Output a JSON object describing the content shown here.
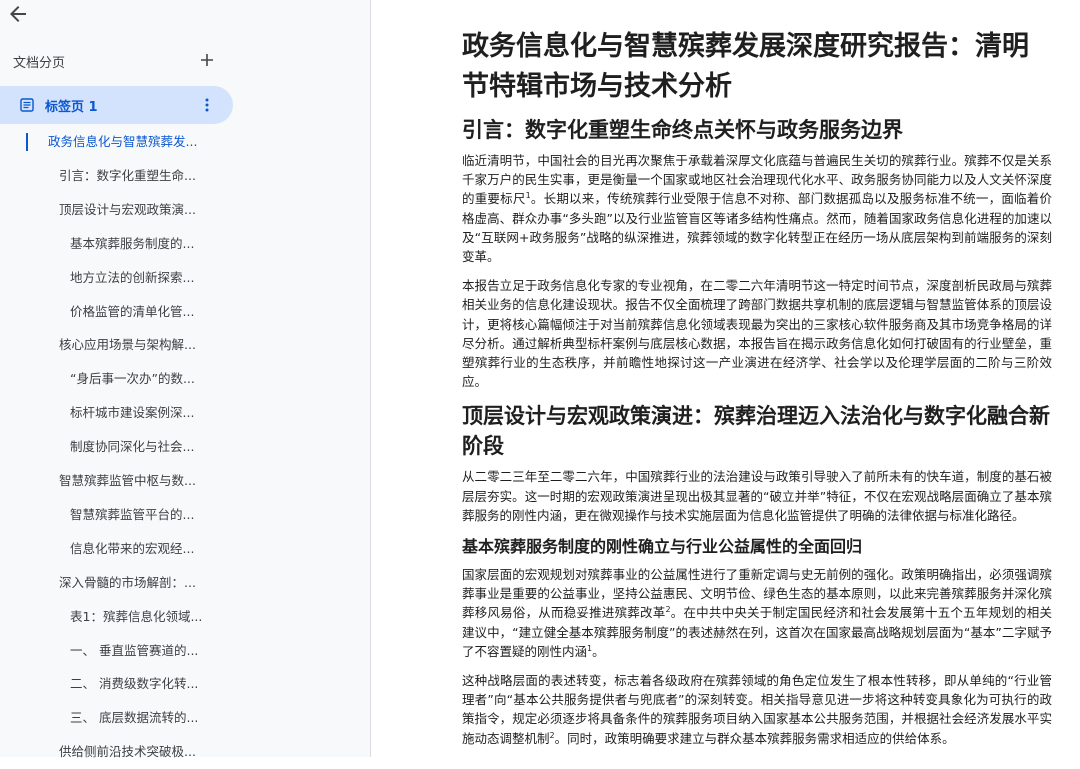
{
  "sidebar": {
    "pages_header": "文档分页",
    "tab_label": "标签页 1",
    "outline": [
      {
        "label": "政务信息化与智慧殡葬发...",
        "level": 1,
        "active": true
      },
      {
        "label": "引言：数字化重塑生命...",
        "level": 2
      },
      {
        "label": "顶层设计与宏观政策演...",
        "level": 2
      },
      {
        "label": "基本殡葬服务制度的...",
        "level": 3
      },
      {
        "label": "地方立法的创新探索...",
        "level": 3
      },
      {
        "label": "价格监管的清单化管...",
        "level": 3
      },
      {
        "label": "核心应用场景与架构解...",
        "level": 2
      },
      {
        "label": "“身后事一次办”的数...",
        "level": 3
      },
      {
        "label": "标杆城市建设案例深...",
        "level": 3
      },
      {
        "label": "制度协同深化与社会...",
        "level": 3
      },
      {
        "label": "智慧殡葬监管中枢与数...",
        "level": 2
      },
      {
        "label": "智慧殡葬监管平台的...",
        "level": 3
      },
      {
        "label": "信息化带来的宏观经...",
        "level": 3
      },
      {
        "label": "深入骨髓的市场解剖：...",
        "level": 2
      },
      {
        "label": "表1：殡葬信息化领域...",
        "level": 3
      },
      {
        "label": "一、 垂直监管赛道的...",
        "level": 3
      },
      {
        "label": "二、 消费级数字化转...",
        "level": 3
      },
      {
        "label": "三、 底层数据流转的...",
        "level": 3
      },
      {
        "label": "供给侧前沿技术突破极...",
        "level": 2
      }
    ]
  },
  "document": {
    "title": "政务信息化与智慧殡葬发展深度研究报告：清明节特辑市场与技术分析",
    "sections": [
      {
        "type": "h2",
        "text": "引言：数字化重塑生命终点关怀与政务服务边界"
      },
      {
        "type": "p",
        "text": "临近清明节，中国社会的目光再次聚焦于承载着深厚文化底蕴与普遍民生关切的殡葬行业。殡葬不仅是关系千家万户的民生实事，更是衡量一个国家或地区社会治理现代化水平、政务服务协同能力以及人文关怀深度的重要标尺",
        "sup": "1",
        "tail": "。长期以来，传统殡葬行业受限于信息不对称、部门数据孤岛以及服务标准不统一，面临着价格虚高、群众办事“多头跑”以及行业监管盲区等诸多结构性痛点。然而，随着国家政务信息化进程的加速以及“互联网+政务服务”战略的纵深推进，殡葬领域的数字化转型正在经历一场从底层架构到前端服务的深刻变革。"
      },
      {
        "type": "p",
        "text": "本报告立足于政务信息化专家的专业视角，在二零二六年清明节这一特定时间节点，深度剖析民政局与殡葬相关业务的信息化建设现状。报告不仅全面梳理了跨部门数据共享机制的底层逻辑与智慧监管体系的顶层设计，更将核心篇幅倾注于对当前殡葬信息化领域表现最为突出的三家核心软件服务商及其市场竞争格局的详尽分析。通过解析典型标杆案例与底层核心数据，本报告旨在揭示政务信息化如何打破固有的行业壁垒，重塑殡葬行业的生态秩序，并前瞻性地探讨这一产业演进在经济学、社会学以及伦理学层面的二阶与三阶效应。"
      },
      {
        "type": "h2",
        "text": "顶层设计与宏观政策演进：殡葬治理迈入法治化与数字化融合新阶段"
      },
      {
        "type": "p",
        "text": "从二零二三年至二零二六年，中国殡葬行业的法治建设与政策引导驶入了前所未有的快车道，制度的基石被层层夯实。这一时期的宏观政策演进呈现出极其显著的“破立并举”特征，不仅在宏观战略层面确立了基本殡葬服务的刚性内涵，更在微观操作与技术实施层面为信息化监管提供了明确的法律依据与标准化路径。"
      },
      {
        "type": "h3",
        "text": "基本殡葬服务制度的刚性确立与行业公益属性的全面回归"
      },
      {
        "type": "p",
        "text": "国家层面的宏观规划对殡葬事业的公益属性进行了重新定调与史无前例的强化。政策明确指出，必须强调殡葬事业是重要的公益事业，坚持公益惠民、文明节俭、绿色生态的基本原则，以此来完善殡葬服务并深化殡葬移风易俗，从而稳妥推进殡葬改革",
        "sup": "2",
        "tail": "。在中共中央关于制定国民经济和社会发展第十五个五年规划的相关建议中，“建立健全基本殡葬服务制度”的表述赫然在列，这首次在国家最高战略规划层面为“基本”二字赋予了不容置疑的刚性内涵",
        "sup2": "1",
        "tail2": "。"
      },
      {
        "type": "p",
        "text": "这种战略层面的表述转变，标志着各级政府在殡葬领域的角色定位发生了根本性转移，即从单纯的“行业管理者”向“基本公共服务提供者与兜底者”的深刻转变。相关指导意见进一步将这种转变具象化为可执行的政策指令，规定必须逐步将具备条件的殡葬服务项目纳入国家基本公共服务范围，并根据社会经济发展水平实施动态调整机制",
        "sup": "2",
        "tail": "。同时，政策明确要求建立与群众基本殡葬服务需求相适应的供给体系。"
      }
    ]
  }
}
